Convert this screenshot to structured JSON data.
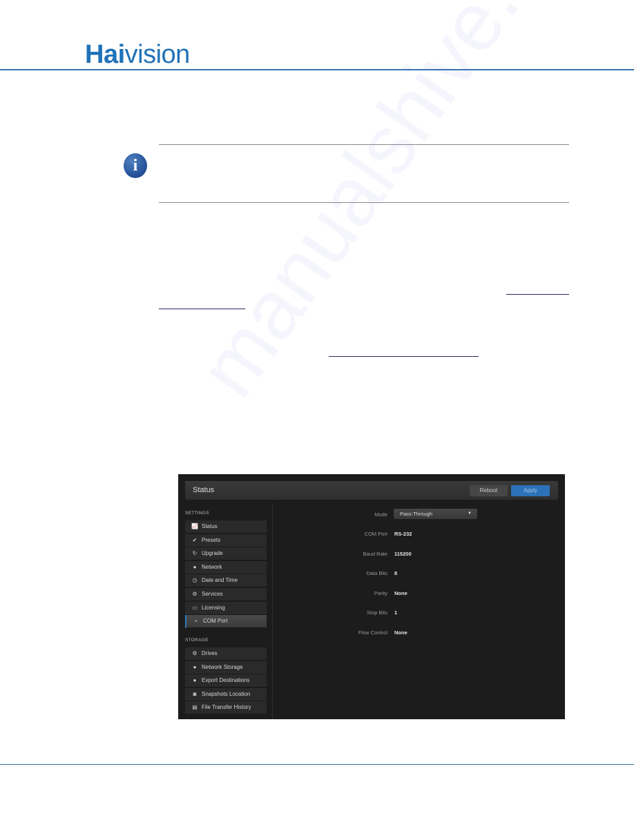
{
  "header": {
    "logo_bold": "Hai",
    "logo_light": "vision"
  },
  "note": {
    "icon": "info-icon",
    "icon_glyph": "i"
  },
  "watermark": "manualshive.com",
  "ui": {
    "title": "Status",
    "buttons": {
      "reboot": "Reboot",
      "apply": "Apply"
    },
    "sidebar": {
      "settings_label": "SETTINGS",
      "settings_items": [
        {
          "label": "Status",
          "icon": "chart-icon",
          "glyph": "📈"
        },
        {
          "label": "Presets",
          "icon": "check-icon",
          "glyph": "✔"
        },
        {
          "label": "Upgrade",
          "icon": "refresh-icon",
          "glyph": "↻"
        },
        {
          "label": "Network",
          "icon": "globe-icon",
          "glyph": "●"
        },
        {
          "label": "Date and Time",
          "icon": "clock-icon",
          "glyph": "◷"
        },
        {
          "label": "Services",
          "icon": "gear-icon",
          "glyph": "⚙"
        },
        {
          "label": "Licensing",
          "icon": "license-card-icon",
          "glyph": "▭"
        },
        {
          "label": "COM Port",
          "icon": "plug-icon",
          "glyph": "⌁",
          "active": true
        }
      ],
      "storage_label": "STORAGE",
      "storage_items": [
        {
          "label": "Drives",
          "icon": "gear-icon",
          "glyph": "⚙"
        },
        {
          "label": "Network Storage",
          "icon": "globe-icon",
          "glyph": "●"
        },
        {
          "label": "Export Destinations",
          "icon": "globe-icon",
          "glyph": "●"
        },
        {
          "label": "Snapshots Location",
          "icon": "camera-icon",
          "glyph": "◙"
        },
        {
          "label": "File Transfer History",
          "icon": "file-icon",
          "glyph": "▤"
        }
      ]
    },
    "form": {
      "mode": {
        "label": "Mode",
        "value": "Pass-Through"
      },
      "fields": [
        {
          "label": "COM Port",
          "value": "RS-232"
        },
        {
          "label": "Baud Rate",
          "value": "115200"
        },
        {
          "label": "Data Bits",
          "value": "8"
        },
        {
          "label": "Parity",
          "value": "None"
        },
        {
          "label": "Stop Bits",
          "value": "1"
        },
        {
          "label": "Flow Control",
          "value": "None"
        }
      ]
    }
  },
  "colors": {
    "brand_blue": "#1f72b8",
    "apply_blue": "#2b72b8",
    "ui_bg": "#1c1c1c"
  }
}
